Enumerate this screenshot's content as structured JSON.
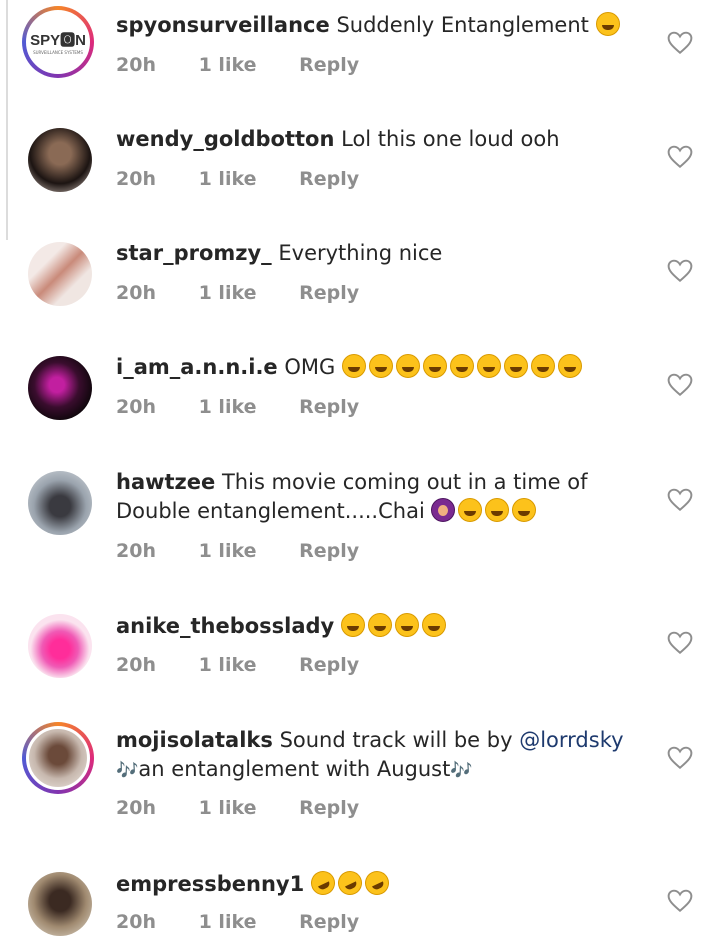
{
  "comments": [
    {
      "username": "spyonsurveillance",
      "text": "Suddenly Entanglement",
      "emojis": [
        "laugh-cry"
      ],
      "time": "20h",
      "likes": "1 like",
      "reply": "Reply",
      "avatar_logo_text": "SPY🅾N",
      "avatar_logo_sub": "SURVEILLANCE SYSTEMS"
    },
    {
      "username": "wendy_goldbotton",
      "text": "Lol this one loud ooh",
      "emojis": [],
      "time": "20h",
      "likes": "1 like",
      "reply": "Reply"
    },
    {
      "username": "star_promzy_",
      "text": "Everything nice",
      "emojis": [],
      "time": "20h",
      "likes": "1 like",
      "reply": "Reply"
    },
    {
      "username": "i_am_a.n.n.i.e",
      "text": "OMG",
      "emojis": [
        "laugh-cry",
        "laugh-cry",
        "laugh-cry",
        "laugh-cry",
        "laugh-cry",
        "laugh-cry",
        "laugh-cry",
        "laugh-cry",
        "laugh-cry"
      ],
      "time": "20h",
      "likes": "1 like",
      "reply": "Reply"
    },
    {
      "username": "hawtzee",
      "text": "This movie coming out in a time of Double entanglement.....Chai",
      "emojis": [
        "woman-gesturing",
        "laugh-cry",
        "laugh-cry",
        "laugh-cry"
      ],
      "time": "20h",
      "likes": "1 like",
      "reply": "Reply"
    },
    {
      "username": "anike_thebosslady",
      "text": "",
      "emojis": [
        "laugh-cry",
        "laugh-cry",
        "laugh-cry",
        "laugh-cry"
      ],
      "time": "20h",
      "likes": "1 like",
      "reply": "Reply"
    },
    {
      "username": "mojisolatalks",
      "text_before": "Sound track will be by",
      "mention": "@lorrdsky",
      "text_after": "an entanglement with August",
      "note": "🎶",
      "time": "20h",
      "likes": "1 like",
      "reply": "Reply"
    },
    {
      "username": "empressbenny1",
      "text": "",
      "emojis": [
        "rofl",
        "rofl",
        "rofl"
      ],
      "time": "20h",
      "likes": "1 like",
      "reply": "Reply"
    }
  ],
  "colors": {
    "username": "#262626",
    "meta": "#8e8e8e",
    "mention": "#1e3a6e",
    "story_ring": "#dd2a7b"
  },
  "icons": {
    "like": "heart-outline-icon"
  }
}
